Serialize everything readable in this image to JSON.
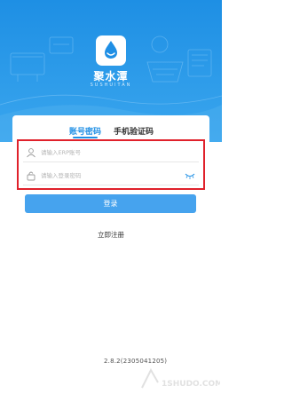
{
  "brand": {
    "title": "聚水潭",
    "subtitle": "SUSHUITAN"
  },
  "tabs": [
    {
      "label": "账号密码",
      "active": true
    },
    {
      "label": "手机验证码",
      "active": false
    }
  ],
  "fields": {
    "erp_placeholder": "请输入ERP账号",
    "password_placeholder": "请输入登录密码"
  },
  "buttons": {
    "login_label": "登录",
    "register_label": "立即注册"
  },
  "footer": {
    "version": "2.8.2(2305041205)"
  },
  "watermark_text": "1SHUDO.COM",
  "colors": {
    "accent": "#1f8fe5",
    "hero": "#2f9cea",
    "button": "#46a3ee",
    "highlight": "#e0212b"
  },
  "icons": [
    "user-icon",
    "lock-icon",
    "eye-closed-icon",
    "water-drop-logo-icon"
  ]
}
